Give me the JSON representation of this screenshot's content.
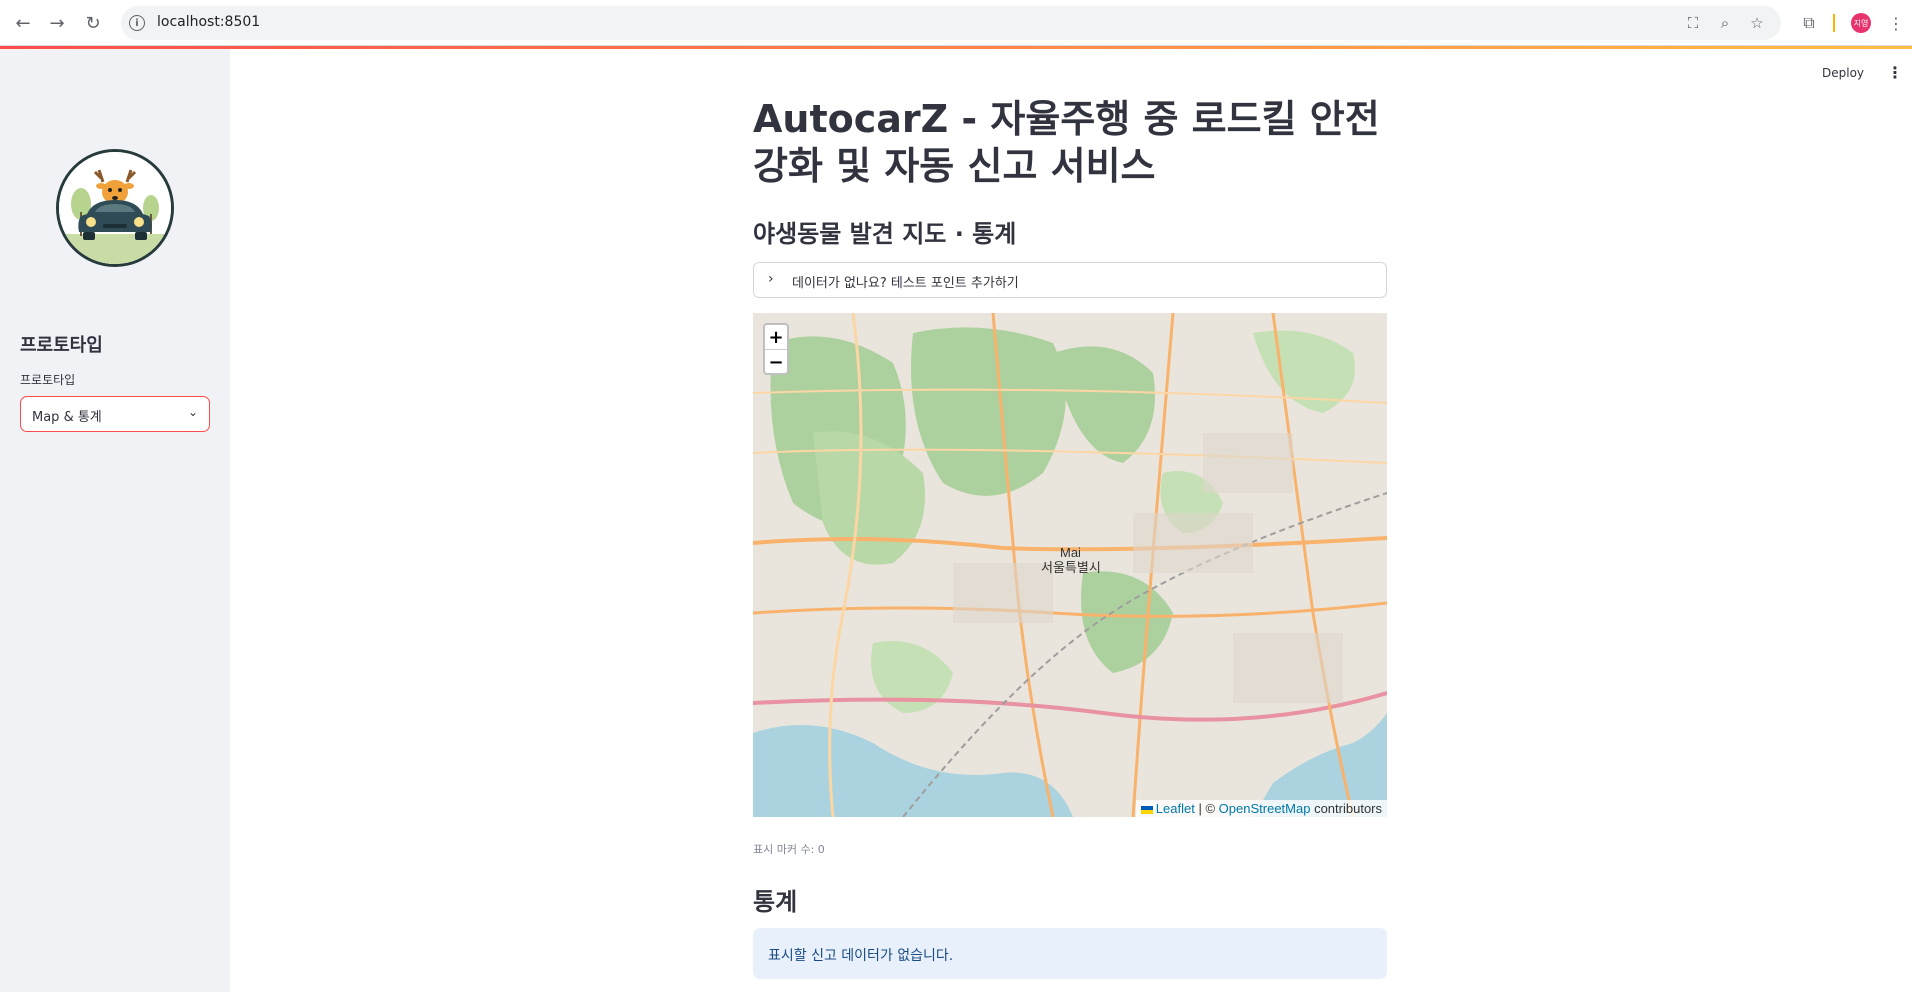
{
  "browser": {
    "url": "localhost:8501",
    "profile_initials": "지영"
  },
  "header": {
    "deploy_label": "Deploy"
  },
  "sidebar": {
    "title": "프로토타입",
    "select_label": "프로토타입",
    "select_value": "Map & 통계"
  },
  "main": {
    "title": "AutocarZ - 자율주행 중 로드킬 안전 강화 및 자동 신고 서비스",
    "map_section_title": "야생동물 발견 지도 · 통계",
    "expander_label": "데이터가 없나요? 테스트 포인트 추가하기",
    "map": {
      "zoom_in": "+",
      "zoom_out": "−",
      "attribution_leaflet": "Leaflet",
      "attribution_sep": "| ©",
      "attribution_osm": "OpenStreetMap",
      "attribution_suffix": "contributors",
      "city_label": "서울특별시",
      "marker_label": "Mai"
    },
    "marker_count_caption": "표시 마커 수: 0",
    "stats_title": "통계",
    "stats_info": "표시할 신고 데이터가 없습니다."
  },
  "colors": {
    "accent": "#ff4b4b",
    "sidebar_bg": "#f0f2f6",
    "info_bg": "#e8f1fb",
    "info_text": "#1b4b84"
  }
}
